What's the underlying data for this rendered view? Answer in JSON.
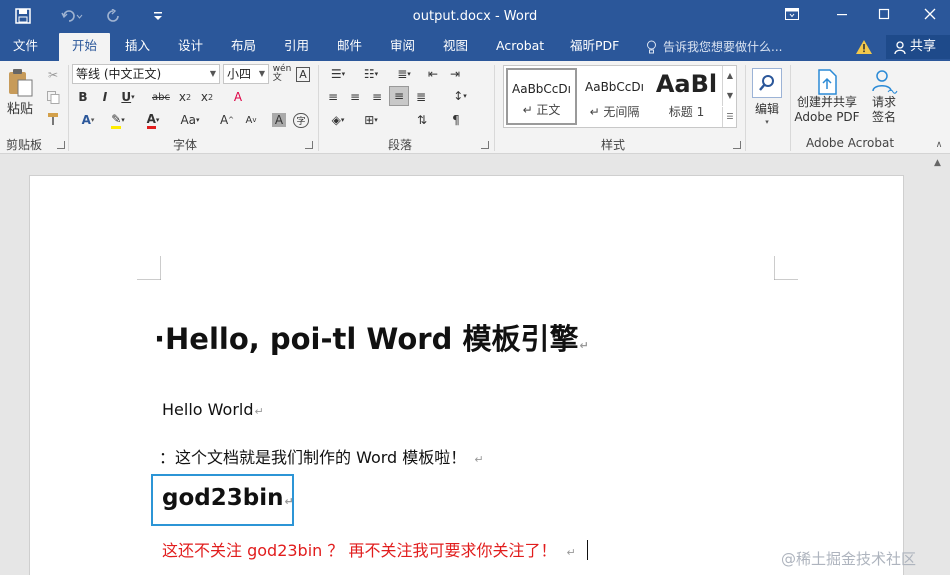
{
  "titlebar": {
    "title": "output.docx - Word",
    "icons": [
      "save-icon",
      "undo-icon",
      "redo-icon",
      "customize-quick-access-icon",
      "ribbon-display-options-icon",
      "minimize-icon",
      "maximize-icon",
      "close-icon"
    ]
  },
  "tabs": [
    "文件",
    "开始",
    "插入",
    "设计",
    "布局",
    "引用",
    "邮件",
    "审阅",
    "视图",
    "Acrobat",
    "福昕PDF"
  ],
  "active_tab": "开始",
  "tell_me": "告诉我您想要做什么...",
  "share": "共享",
  "colors": {
    "accent": "#2b579a",
    "selection_box": "#2c95d6",
    "red_text": "#e11d1d"
  },
  "ribbon": {
    "clipboard": {
      "paste": "粘贴",
      "label": "剪贴板"
    },
    "font": {
      "name": "等线 (中文正文)",
      "size": "小四",
      "label": "字体"
    },
    "paragraph": {
      "label": "段落"
    },
    "styles": {
      "label": "样式",
      "items": [
        {
          "preview": "AaBbCcDı",
          "name": "↵ 正文"
        },
        {
          "preview": "AaBbCcDı",
          "name": "↵ 无间隔"
        },
        {
          "preview": "AaBl",
          "name": "标题 1"
        }
      ]
    },
    "editing": {
      "label": "编辑"
    },
    "acrobat": {
      "create": "创建并共享",
      "create2": "Adobe PDF",
      "sign": "请求",
      "sign2": "签名",
      "label": "Adobe Acrobat"
    }
  },
  "document": {
    "heading": "·Hello, poi-tl Word 模板引擎",
    "hello": "Hello World",
    "intro": "：这个文档就是我们制作的  Word  模板啦！",
    "author": "god23bin",
    "red_line": "这还不关注  god23bin  ？ 再不关注我可要求你关注了！",
    "para_mark": "↵"
  },
  "watermark": "@稀土掘金技术社区"
}
